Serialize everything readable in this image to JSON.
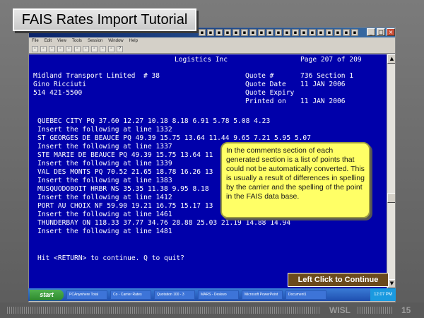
{
  "slide": {
    "title": "FAIS Rates Import Tutorial",
    "footer_org": "WISL",
    "page_number": "15",
    "continue_label": "Left Click to Continue"
  },
  "window": {
    "menu_items": [
      "File",
      "Edit",
      "View",
      "Tools",
      "Session",
      "Window",
      "Help"
    ],
    "icon_names": [
      "new-icon",
      "open-icon",
      "save-icon",
      "print-icon",
      "cut-icon",
      "copy-icon",
      "paste-icon",
      "find-icon",
      "undo-icon",
      "redo-icon",
      "help-icon"
    ]
  },
  "terminal": {
    "company": "Logistics Inc",
    "page_info": "Page 207 of 209",
    "customer": "Midland Transport Limited  # 38",
    "contact": "Gino Ricciuti",
    "phone": "514 421-5500",
    "quote_no_label": "Quote #",
    "quote_no_value": "736 Section 1",
    "quote_date_label": "Quote Date",
    "quote_date_value": "11 JAN 2006",
    "quote_expiry_label": "Quote Expiry",
    "printed_on_label": "Printed on",
    "printed_on_value": "11 JAN 2006",
    "rows": [
      "QUEBEC CITY PQ 37.60 12.27 10.18 8.18 6.91 5.78 5.08 4.23",
      "Insert the following at line 1332",
      "ST GEORGES DE BEAUCE PQ 49.39 15.75 13.64 11.44 9.65 7.21 5.95 5.07",
      "Insert the following at line 1337",
      "STE MARIE DE BEAUCE PQ 49.39 15.75 13.64 11",
      "Insert the following at line 1339",
      "VAL DES MONTS PQ 70.52 21.65 18.78 16.26 13",
      "Insert the following at line 1383",
      "MUSQUODOBOIT HRBR NS 35.35 11.38 9.95 8.18",
      "Insert the following at line 1412",
      "PORT AU CHOIX NF 59.90 19.21 16.75 15.17 13",
      "Insert the following at line 1461",
      "THUNDERBAY ON 118.33 37.77 34.76 28.88 25.03 21.19 14.88 14.94",
      "Insert the following at line 1481"
    ],
    "prompt": "Hit <RETURN> to continue. Q to quit?"
  },
  "callout": {
    "text": "In the comments section of each generated section is a list of points that could not be automatically converted. This is usually a result of differences in spelling by the carrier and the spelling of the point in the FAIS data base."
  },
  "taskbar": {
    "start_label": "start",
    "items": [
      "PCAnywhere Total",
      "Co - Carrier Rates",
      "Quotation 100 - 3",
      "MARS - Deskwo",
      "Microsoft PowerPoint",
      "Document1"
    ],
    "clock": "12:07 PM"
  }
}
